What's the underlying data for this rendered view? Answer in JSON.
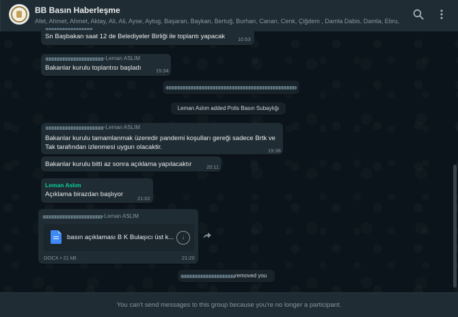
{
  "header": {
    "title": "BB Basın Haberleşme",
    "participants": "Afet, Ahmet, Ahmet, Aktay, Ali, Ali, Ayse, Aytug, Başaran, Baykan, Bertuğ, Burhan, Canan, Cenk, Çiğdem , Damla Dabis, Damla, Ebru, Em...",
    "search_icon": "search-icon",
    "menu_icon": "kebab-menu-icon"
  },
  "messages": [
    {
      "text": "Sn Başbakan saat 12 de Belediyeler Birliği ile toplantı yapacak",
      "time": "10:53"
    },
    {
      "sender": "~Leman ASLIM",
      "text": "Bakanlar kurulu toplantısı başladı",
      "time": "15:34"
    },
    {
      "system": "Leman Aslım added Polis Basın Subaylığı"
    },
    {
      "sender": "~Leman ASLIM",
      "line1": "Bakanlar kurulu tamamlanmak üzeredir pandemi koşulları gereği sadece  Brtk ve",
      "line2": "Tak tarafından izlenmesi uygun olacaktir.",
      "time": "19:38"
    },
    {
      "text": "Bakanlar kurulu bitti az sonra açıklama yapılacaktır",
      "time": "20:11"
    },
    {
      "sender": "Leman Aslım",
      "text": "Açıklama birazdan başlıyor",
      "time": "21:02"
    },
    {
      "sender": "~Leman ASLIM",
      "doc_name": "basın açıklaması B K Bulaşıcı üst k...",
      "doc_meta": "DOCX • 21 kB",
      "time": "21:20"
    },
    {
      "system_suffix": "removed you"
    }
  ],
  "footer": {
    "notice": "You can't send messages to this group because you're no longer a participant."
  },
  "colors": {
    "background": "#0b141a",
    "bubble": "#202c33",
    "header": "#202c33",
    "sender_green": "#06cf9c"
  }
}
